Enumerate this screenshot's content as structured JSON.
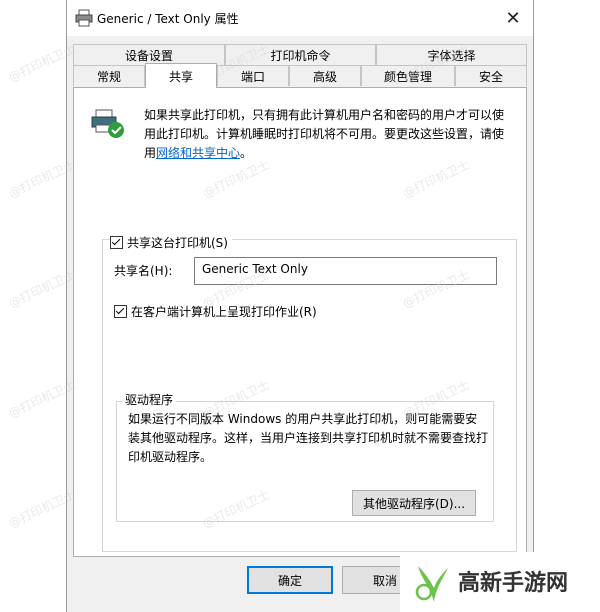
{
  "window": {
    "title": "Generic / Text Only 属性",
    "close_glyph": "✕"
  },
  "tabs": {
    "row_back": [
      "设备设置",
      "打印机命令",
      "字体选择"
    ],
    "row_front": [
      "常规",
      "共享",
      "端口",
      "高级",
      "颜色管理",
      "安全"
    ],
    "active": "共享"
  },
  "info": {
    "text": "如果共享此打印机，只有拥有此计算机用户名和密码的用户才可以使用此打印机。计算机睡眠时打印机将不可用。要更改这些设置，请使用",
    "link": "网络和共享中心",
    "suffix": "。"
  },
  "share": {
    "checkbox_label": "共享这台打印机(S)",
    "checked": true,
    "name_label": "共享名(H):",
    "name_value": "Generic  Text Only",
    "render_checkbox_label": "在客户端计算机上呈现打印作业(R)",
    "render_checked": true
  },
  "drivers": {
    "legend": "驱动程序",
    "text": "如果运行不同版本 Windows 的用户共享此打印机，则可能需要安装其他驱动程序。这样，当用户连接到共享打印机时就不需要查找打印机驱动程序。",
    "button": "其他驱动程序(D)..."
  },
  "footer": {
    "ok": "确定",
    "cancel": "取消"
  },
  "watermark": "@打印机卫士",
  "logo": {
    "text": "高新手游网"
  },
  "colors": {
    "link": "#0066cc",
    "focus": "#0078d7",
    "check_green": "#2e9e3a"
  }
}
